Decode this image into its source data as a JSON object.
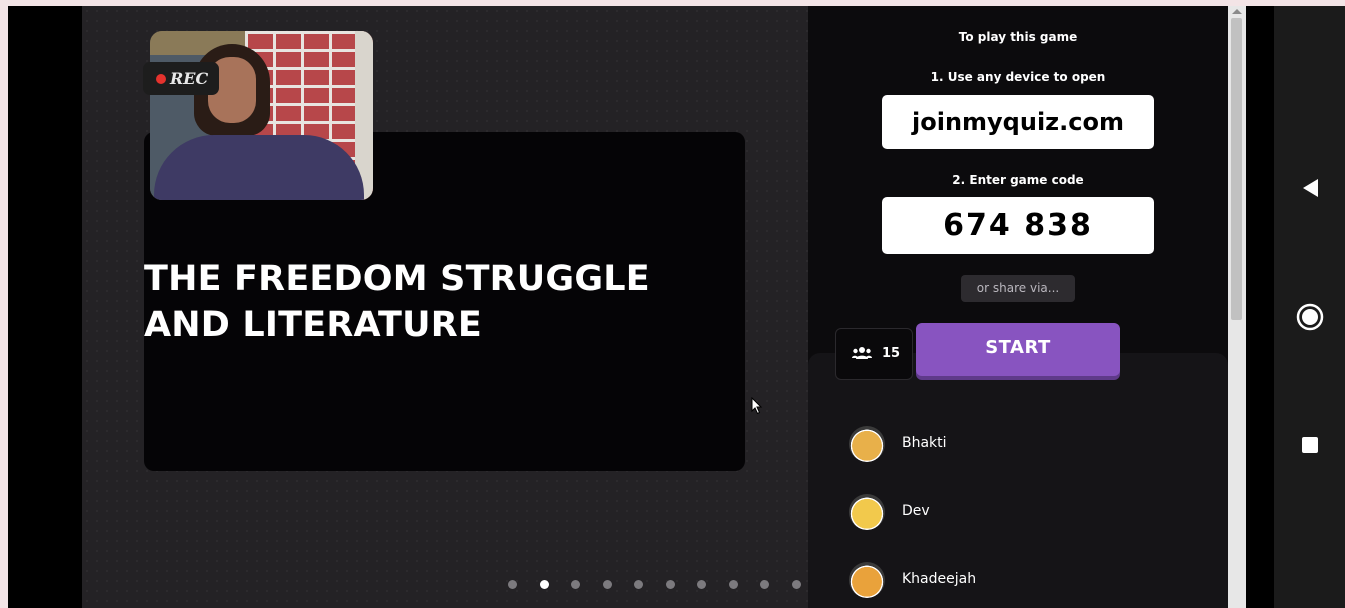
{
  "webcam": {
    "rec_label": "REC"
  },
  "slide": {
    "title": "THE FREEDOM STRUGGLE AND LITERATURE",
    "page_count": 10,
    "current_page": 2
  },
  "panel": {
    "heading": "To play this game",
    "step1": "1. Use any device to open",
    "join_url": "joinmyquiz.com",
    "step2": "2. Enter game code",
    "game_code": "674 838",
    "share_label": "or share via...",
    "player_count": "15",
    "start_label": "START"
  },
  "players": [
    {
      "name": "Bhakti",
      "avatar_color": "#e8b04a"
    },
    {
      "name": "Dev",
      "avatar_color": "#f2c94c"
    },
    {
      "name": "Khadeejah",
      "avatar_color": "#e9a23b"
    }
  ],
  "system_nav": {
    "back_icon": "back-triangle-icon",
    "home_icon": "home-circle-icon",
    "recents_icon": "recents-square-icon"
  },
  "colors": {
    "accent": "#8854c0",
    "rec": "#e5322d"
  }
}
